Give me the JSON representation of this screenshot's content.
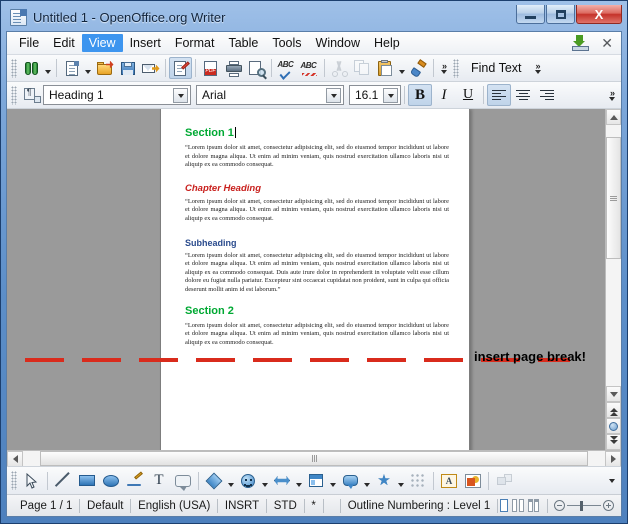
{
  "window": {
    "title": "Untitled 1 - OpenOffice.org Writer",
    "icon": "writer-document-icon",
    "controls": {
      "minimize": "minimize-button",
      "restore": "restore-button",
      "close": "close-button",
      "close_glyph": "X"
    }
  },
  "menubar": {
    "items": [
      {
        "label": "File",
        "accel": "F",
        "active": false
      },
      {
        "label": "Edit",
        "accel": "E",
        "active": false
      },
      {
        "label": "View",
        "accel": "V",
        "active": true
      },
      {
        "label": "Insert",
        "accel": "I",
        "active": false
      },
      {
        "label": "Format",
        "accel": "o",
        "active": false
      },
      {
        "label": "Table",
        "accel": "a",
        "active": false
      },
      {
        "label": "Tools",
        "accel": "T",
        "active": false
      },
      {
        "label": "Window",
        "accel": "W",
        "active": false
      },
      {
        "label": "Help",
        "accel": "H",
        "active": false
      }
    ],
    "right_icons": [
      "save-document-icon",
      "close-document-icon"
    ],
    "close_document_glyph": "✕"
  },
  "standard_toolbar": {
    "buttons": [
      {
        "name": "find-binoculars-icon",
        "tooltip": "Find & Replace",
        "has_dropdown": true
      },
      {
        "name": "new-document-icon",
        "tooltip": "New",
        "has_dropdown": true
      },
      {
        "name": "open-folder-icon",
        "tooltip": "Open"
      },
      {
        "name": "save-icon",
        "tooltip": "Save"
      },
      {
        "name": "email-document-icon",
        "tooltip": "E-mail Document"
      },
      {
        "name": "edit-file-icon",
        "tooltip": "Edit File",
        "pressed": true
      },
      {
        "name": "export-pdf-icon",
        "tooltip": "Export Directly as PDF"
      },
      {
        "name": "print-icon",
        "tooltip": "Print File Directly"
      },
      {
        "name": "print-preview-icon",
        "tooltip": "Page Preview"
      },
      {
        "name": "spelling-check-icon",
        "tooltip": "Spelling and Grammar"
      },
      {
        "name": "autospellcheck-icon",
        "tooltip": "AutoSpellcheck"
      },
      {
        "name": "cut-icon",
        "tooltip": "Cut",
        "disabled": true
      },
      {
        "name": "copy-icon",
        "tooltip": "Copy",
        "disabled": true
      },
      {
        "name": "paste-icon",
        "tooltip": "Paste",
        "has_dropdown": true
      },
      {
        "name": "clone-formatting-icon",
        "tooltip": "Clone Formatting"
      }
    ],
    "overflow_glyph": "»"
  },
  "find_toolbar": {
    "label": "Find Text",
    "overflow_glyph": "»"
  },
  "formatting_toolbar": {
    "paragraph_style_icon": "paragraph-style-icon",
    "paragraph_style": "Heading 1",
    "font_name": "Arial",
    "font_size": "16.1",
    "bold_label": "B",
    "italic_label": "I",
    "underline_label": "U",
    "bold_active": true,
    "align_left_active": true,
    "overflow_glyph": "»"
  },
  "document": {
    "headings": {
      "section1": "Section 1",
      "chapter": "Chapter Heading",
      "subheading": "Subheading",
      "section2": "Section 2"
    },
    "colors": {
      "section": "#00a933",
      "chapter": "#c9211e",
      "subheading": "#2a4b8d"
    },
    "paragraphs": {
      "short": "“Lorem ipsum dolor sit amet, consectetur adipisicing elit, sed do eiusmod tempor incididunt ut labore et dolore magna aliqua. Ut enim ad minim veniam, quis nostrud exercitation ullamco laboris nisi ut aliquip ex ea commodo consequat.",
      "long": "“Lorem ipsum dolor sit amet, consectetur adipisicing elit, sed do eiusmod tempor incididunt ut labore et dolore magna aliqua. Ut enim ad minim veniam, quis nostrud exercitation ullamco laboris nisi ut aliquip ex ea commodo consequat. Duis aute irure dolor in reprehenderit in voluptate velit esse cillum dolore eu fugiat nulla pariatur. Excepteur sint occaecat cupidatat non proident, sunt in culpa qui officia deserunt mollit anim id est laborum.”"
    }
  },
  "annotation": {
    "text": "insert page break!",
    "line_color": "#d92b1c",
    "text_color": "#000000"
  },
  "scrollbars": {
    "vertical": {
      "up_arrow": "scroll-up-arrow",
      "down_arrow": "scroll-down-arrow",
      "previous_page": "previous-page-button",
      "navigator": "navigator-button",
      "next_page": "next-page-button"
    },
    "horizontal": {
      "left_arrow": "scroll-left-arrow",
      "right_arrow": "scroll-right-arrow"
    }
  },
  "drawing_toolbar": {
    "tools": [
      {
        "name": "select-arrow-icon",
        "label": "Select"
      },
      {
        "name": "line-icon",
        "label": "Line"
      },
      {
        "name": "rectangle-icon",
        "label": "Rectangle"
      },
      {
        "name": "ellipse-icon",
        "label": "Ellipse"
      },
      {
        "name": "freeform-line-icon",
        "label": "Freeform Line"
      },
      {
        "name": "text-box-icon",
        "label": "Text Box"
      },
      {
        "name": "callout-icon",
        "label": "Callouts"
      },
      {
        "name": "basic-shapes-icon",
        "label": "Basic Shapes",
        "has_dropdown": true
      },
      {
        "name": "symbol-shapes-icon",
        "label": "Symbol Shapes",
        "has_dropdown": true
      },
      {
        "name": "block-arrows-icon",
        "label": "Block Arrows",
        "has_dropdown": true
      },
      {
        "name": "flowchart-icon",
        "label": "Flowchart",
        "has_dropdown": true
      },
      {
        "name": "callout-shapes-icon",
        "label": "Callouts",
        "has_dropdown": true
      },
      {
        "name": "stars-icon",
        "label": "Stars",
        "has_dropdown": true
      },
      {
        "name": "points-icon",
        "label": "Points"
      },
      {
        "name": "fontwork-gallery-icon",
        "label": "Fontwork Gallery"
      },
      {
        "name": "insert-image-icon",
        "label": "From File"
      },
      {
        "name": "toggle-extrusion-icon",
        "label": "Extrusion On/Off",
        "disabled": true
      }
    ],
    "fontwork_letter": "A",
    "star_glyph": "★",
    "overflow_glyph": "▼"
  },
  "statusbar": {
    "page": "Page 1 / 1",
    "page_style": "Default",
    "language": "English (USA)",
    "insert_mode": "INSRT",
    "selection_mode": "STD",
    "modified": "*",
    "outline": "Outline Numbering : Level 1",
    "view_layouts": [
      "single-page-view-icon",
      "multi-page-view-icon",
      "book-view-icon"
    ],
    "zoom_out": "zoom-out-button",
    "zoom_in": "zoom-in-button",
    "zoom_slider": "zoom-slider"
  }
}
